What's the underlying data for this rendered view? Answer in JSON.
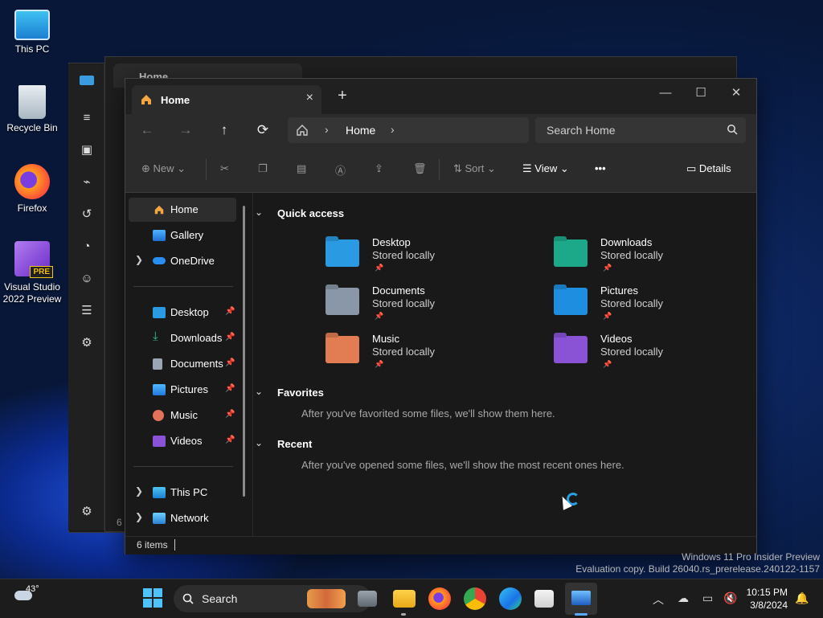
{
  "desktop": {
    "icons": [
      {
        "label": "This PC",
        "icon": "monitor-icon"
      },
      {
        "label": "Recycle Bin",
        "icon": "recycle-bin-icon"
      },
      {
        "label": "Firefox",
        "icon": "firefox-icon"
      },
      {
        "label": "Visual Studio 2022 Preview",
        "icon": "visual-studio-icon",
        "badge": "PRE"
      }
    ]
  },
  "background_window": {
    "tab_title": "Home",
    "status_fragment": "6"
  },
  "explorer": {
    "tab": {
      "title": "Home",
      "close": "×",
      "new_tab": "+"
    },
    "window_controls": {
      "minimize": "—",
      "maximize": "☐",
      "close": "✕"
    },
    "nav": {
      "back": "←",
      "forward": "→",
      "up": "↑",
      "refresh": "⟳"
    },
    "address": {
      "crumb": "Home",
      "chevron": "›"
    },
    "search": {
      "placeholder": "Search Home"
    },
    "commands": {
      "new": "New",
      "sort": "Sort",
      "view": "View",
      "more": "•••",
      "details": "Details"
    },
    "nav_pane": {
      "top": [
        {
          "label": "Home",
          "icon": "home-icon",
          "selected": true
        },
        {
          "label": "Gallery",
          "icon": "gallery-icon"
        },
        {
          "label": "OneDrive",
          "icon": "onedrive-icon",
          "expandable": true
        }
      ],
      "pinned": [
        {
          "label": "Desktop",
          "icon": "desktop-folder-icon"
        },
        {
          "label": "Downloads",
          "icon": "downloads-icon"
        },
        {
          "label": "Documents",
          "icon": "documents-icon"
        },
        {
          "label": "Pictures",
          "icon": "pictures-icon"
        },
        {
          "label": "Music",
          "icon": "music-icon"
        },
        {
          "label": "Videos",
          "icon": "videos-icon"
        }
      ],
      "bottom": [
        {
          "label": "This PC",
          "icon": "this-pc-icon"
        },
        {
          "label": "Network",
          "icon": "network-icon"
        }
      ]
    },
    "sections": {
      "quick_access": "Quick access",
      "favorites": "Favorites",
      "favorites_empty": "After you've favorited some files, we'll show them here.",
      "recent": "Recent",
      "recent_empty": "After you've opened some files, we'll show the most recent ones here."
    },
    "quick_access_items": [
      {
        "name": "Desktop",
        "sub": "Stored locally",
        "color": "#2a9be3"
      },
      {
        "name": "Downloads",
        "sub": "Stored locally",
        "color": "#1ca98a"
      },
      {
        "name": "Documents",
        "sub": "Stored locally",
        "color": "#8a97a8"
      },
      {
        "name": "Pictures",
        "sub": "Stored locally",
        "color": "#1e8fe0"
      },
      {
        "name": "Music",
        "sub": "Stored locally",
        "color": "#e27c52"
      },
      {
        "name": "Videos",
        "sub": "Stored locally",
        "color": "#8a53d6"
      }
    ],
    "status": {
      "count": "6 items"
    }
  },
  "watermark": {
    "line1": "Windows 11 Pro Insider Preview",
    "line2": "Evaluation copy. Build 26040.rs_prerelease.240122-1157"
  },
  "taskbar": {
    "weather_temp": "43°",
    "search_label": "Search",
    "time": "10:15 PM",
    "date": "3/8/2024"
  }
}
